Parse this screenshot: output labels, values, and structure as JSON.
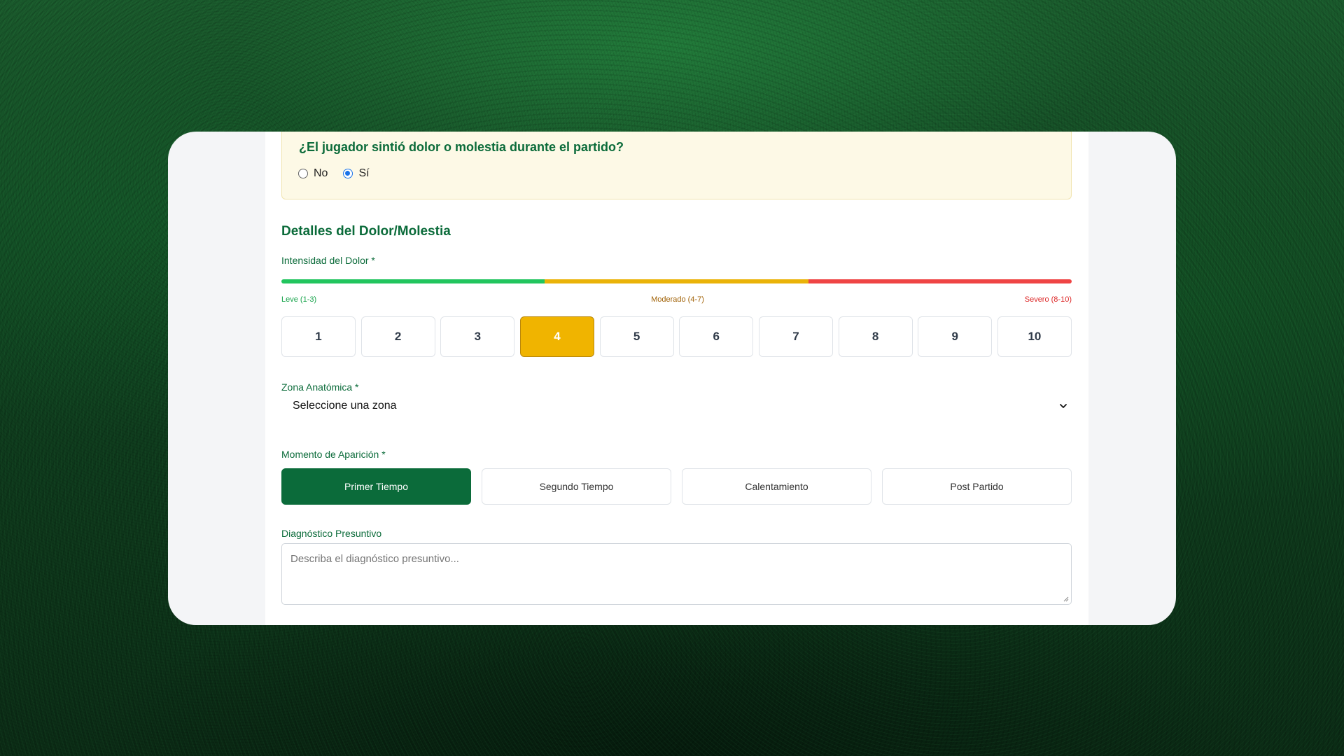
{
  "pain_question": {
    "title": "¿El jugador sintió dolor o molestia durante el partido?",
    "options": [
      {
        "label": "No",
        "checked": false
      },
      {
        "label": "Sí",
        "checked": true
      }
    ]
  },
  "details": {
    "section_title": "Detalles del Dolor/Molestia",
    "intensity": {
      "label": "Intensidad del Dolor *",
      "scale_labels": {
        "mild": "Leve (1-3)",
        "moderate": "Moderado (4-7)",
        "severe": "Severo (8-10)"
      },
      "values": [
        "1",
        "2",
        "3",
        "4",
        "5",
        "6",
        "7",
        "8",
        "9",
        "10"
      ],
      "selected": "4"
    },
    "zone": {
      "label": "Zona Anatómica *",
      "value": "Seleccione una zona"
    },
    "moment": {
      "label": "Momento de Aparición *",
      "options": [
        "Primer Tiempo",
        "Segundo Tiempo",
        "Calentamiento",
        "Post Partido"
      ],
      "selected": "Primer Tiempo"
    },
    "diagnosis": {
      "label": "Diagnóstico Presuntivo",
      "placeholder": "Describa el diagnóstico presuntivo..."
    }
  },
  "colors": {
    "brand_green": "#0b6b3a",
    "mild": "#22c55e",
    "moderate": "#eab308",
    "severe": "#ef4444",
    "selected_intensity": "#f0b400",
    "radio_blue": "#1a73e8"
  },
  "icons": {
    "zone_dropdown": "chevron-down-icon",
    "textarea_resize": "resize-grip-icon"
  }
}
